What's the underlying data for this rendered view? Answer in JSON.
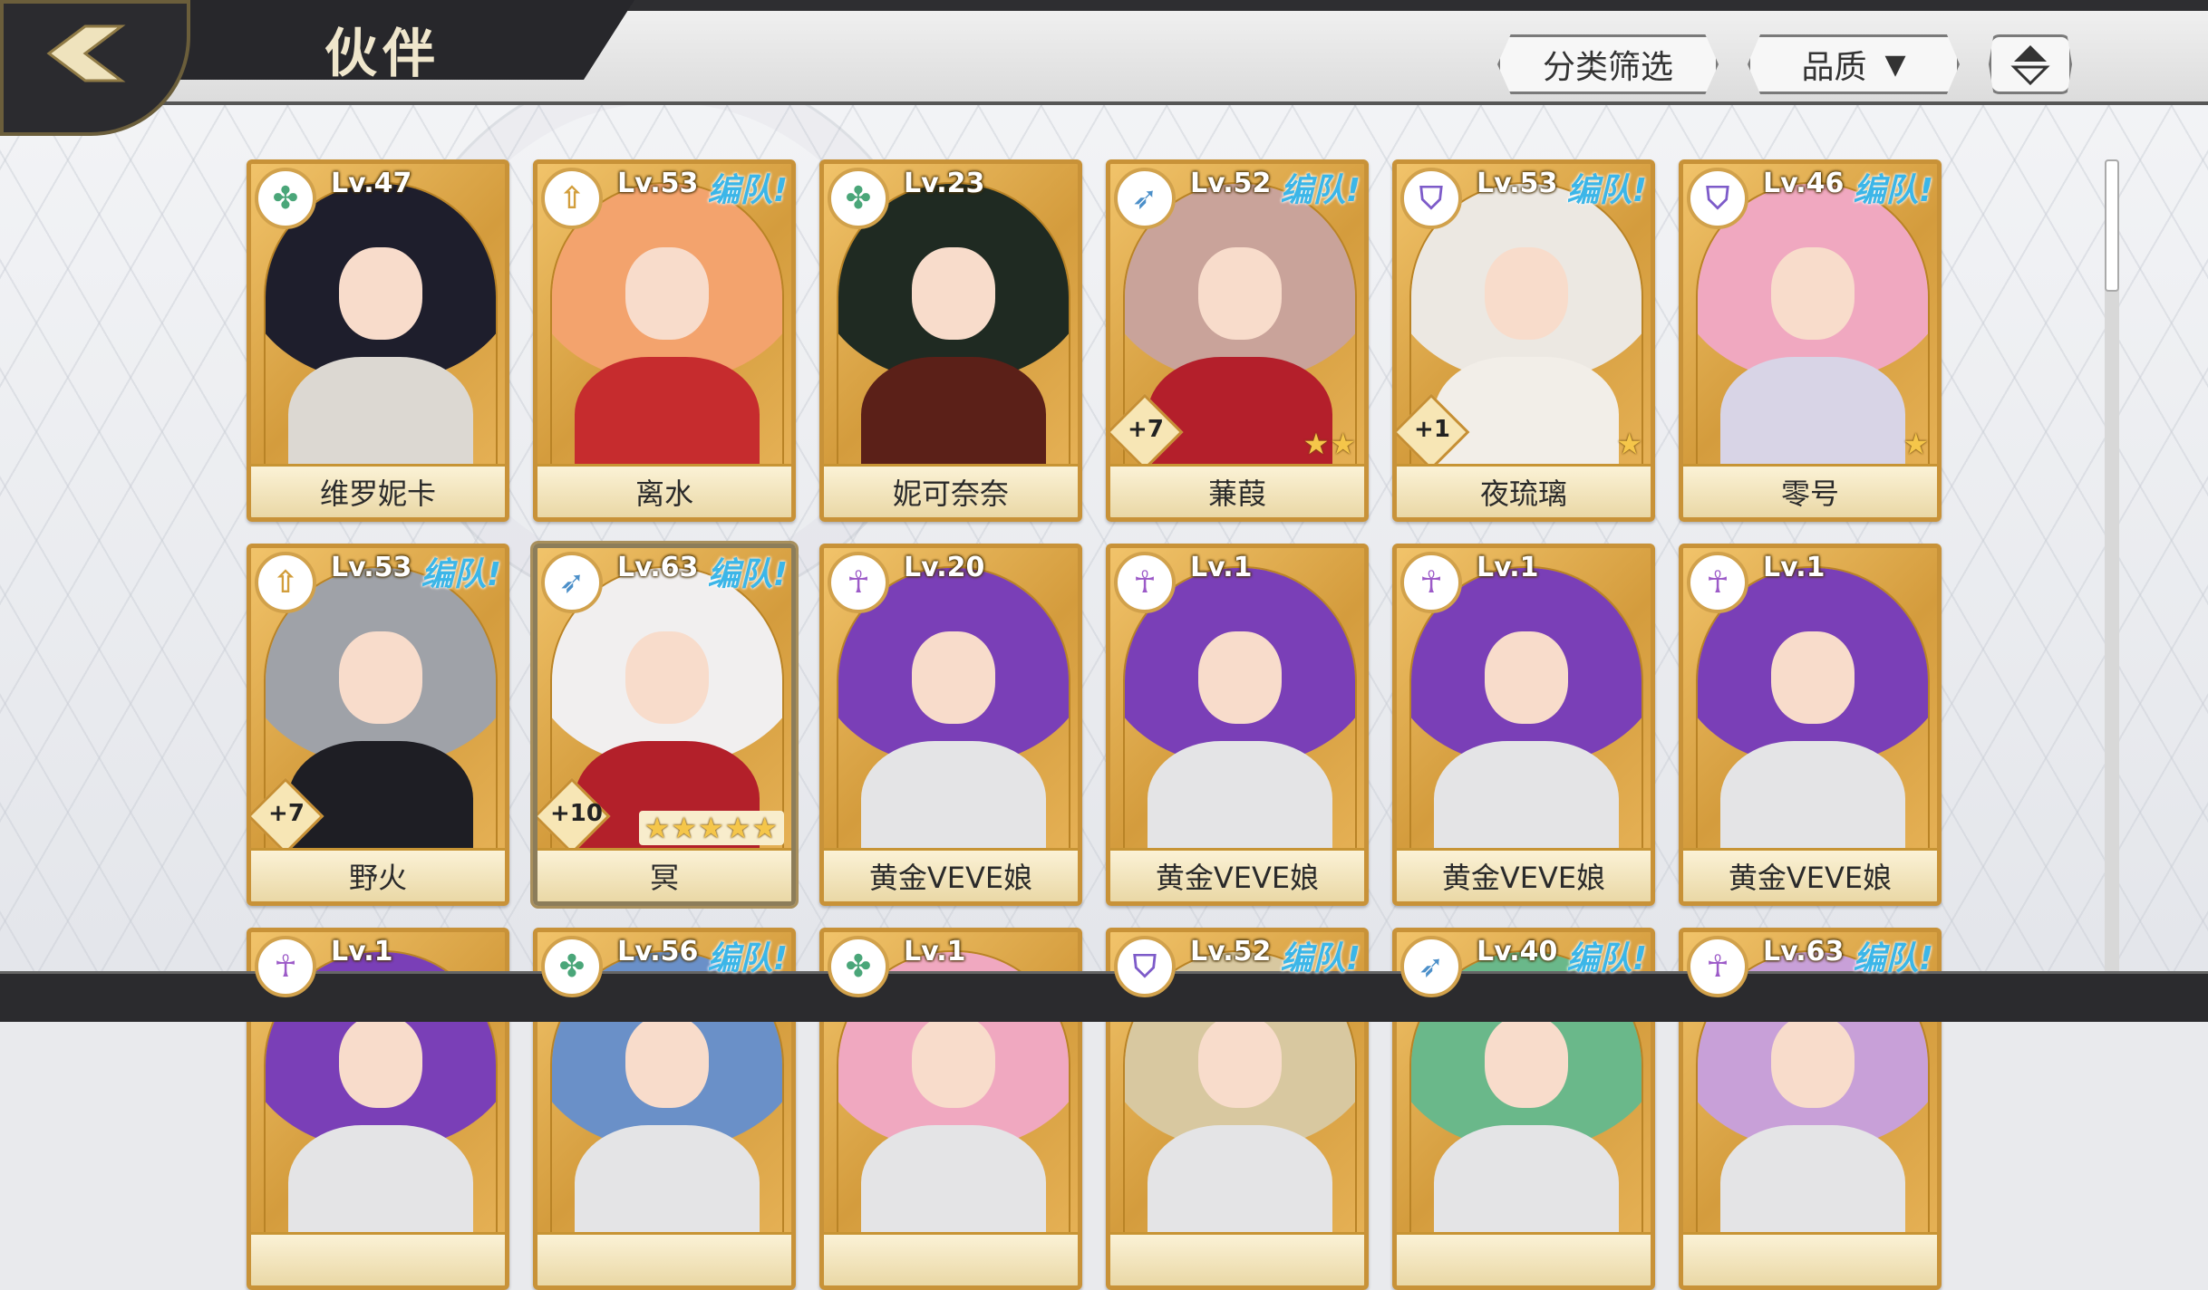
{
  "header": {
    "title": "伙伴",
    "filter_label": "分类筛选",
    "quality_label": "品质"
  },
  "accent": {
    "team_color": "#3cb6e8",
    "card_gold": "#d49c3d"
  },
  "team_tag": "编队!",
  "cards": [
    {
      "level": "Lv.47",
      "name": "维罗妮卡",
      "class_icon": "clover-icon",
      "icon_color": "#4aa679",
      "icon_glyph": "✤",
      "team": "",
      "plus": "",
      "stars": "",
      "hair": "#1e1e2c",
      "body": "#dcd8d2"
    },
    {
      "level": "Lv.53",
      "name": "离水",
      "class_icon": "sword-icon",
      "icon_color": "#d29e3c",
      "icon_glyph": "⇧",
      "team": "编队!",
      "plus": "",
      "stars": "",
      "hair": "#f3a36d",
      "body": "#c62c2e"
    },
    {
      "level": "Lv.23",
      "name": "妮可奈奈",
      "class_icon": "clover-icon",
      "icon_color": "#4aa679",
      "icon_glyph": "✤",
      "team": "",
      "plus": "",
      "stars": "",
      "hair": "#1f2a22",
      "body": "#5b2018"
    },
    {
      "level": "Lv.52",
      "name": "蒹葭",
      "class_icon": "bow-icon",
      "icon_color": "#4b8fc9",
      "icon_glyph": "➶",
      "team": "编队!",
      "plus": "+7",
      "stars": "★★",
      "hair": "#c9a39a",
      "body": "#b41f2b"
    },
    {
      "level": "Lv.53",
      "name": "夜琉璃",
      "class_icon": "shield-icon",
      "icon_color": "#7d5bc9",
      "icon_glyph": "⛉",
      "team": "编队!",
      "plus": "+1",
      "stars": "★",
      "hair": "#ece8e2",
      "body": "#f2eee8"
    },
    {
      "level": "Lv.46",
      "name": "零号",
      "class_icon": "shield-icon",
      "icon_color": "#7d5bc9",
      "icon_glyph": "⛉",
      "team": "编队!",
      "plus": "",
      "stars": "★",
      "hair": "#f0a8c0",
      "body": "#d8d4e6"
    },
    {
      "level": "Lv.53",
      "name": "野火",
      "class_icon": "sword-icon",
      "icon_color": "#d29e3c",
      "icon_glyph": "⇧",
      "team": "编队!",
      "plus": "+7",
      "stars": "",
      "hair": "#9fa2a8",
      "body": "#1e1e24"
    },
    {
      "level": "Lv.63",
      "name": "冥",
      "class_icon": "bow-icon",
      "icon_color": "#4b8fc9",
      "icon_glyph": "➶",
      "team": "编队!",
      "plus": "+10",
      "stars": "★★★★★",
      "hair": "#f1efef",
      "body": "#b3202a"
    },
    {
      "level": "Lv.20",
      "name": "黄金VEVE娘",
      "class_icon": "ankh-icon",
      "icon_color": "#9c5ac8",
      "icon_glyph": "☥",
      "team": "",
      "plus": "",
      "stars": "",
      "hair": "#7a3fb7",
      "body": "#e4e4e6"
    },
    {
      "level": "Lv.1",
      "name": "黄金VEVE娘",
      "class_icon": "ankh-icon",
      "icon_color": "#9c5ac8",
      "icon_glyph": "☥",
      "team": "",
      "plus": "",
      "stars": "",
      "hair": "#7a3fb7",
      "body": "#e4e4e6"
    },
    {
      "level": "Lv.1",
      "name": "黄金VEVE娘",
      "class_icon": "ankh-icon",
      "icon_color": "#9c5ac8",
      "icon_glyph": "☥",
      "team": "",
      "plus": "",
      "stars": "",
      "hair": "#7a3fb7",
      "body": "#e4e4e6"
    },
    {
      "level": "Lv.1",
      "name": "黄金VEVE娘",
      "class_icon": "ankh-icon",
      "icon_color": "#9c5ac8",
      "icon_glyph": "☥",
      "team": "",
      "plus": "",
      "stars": "",
      "hair": "#7a3fb7",
      "body": "#e4e4e6"
    },
    {
      "level": "Lv.1",
      "name": "",
      "class_icon": "ankh-icon",
      "icon_color": "#9c5ac8",
      "icon_glyph": "☥",
      "team": "",
      "plus": "",
      "stars": "",
      "hair": "#7a3fb7",
      "body": "#e4e4e6"
    },
    {
      "level": "Lv.56",
      "name": "",
      "class_icon": "clover-icon",
      "icon_color": "#4aa679",
      "icon_glyph": "✤",
      "team": "编队!",
      "plus": "",
      "stars": "",
      "hair": "#6a90c8",
      "body": "#e4e4e6"
    },
    {
      "level": "Lv.1",
      "name": "",
      "class_icon": "clover-icon",
      "icon_color": "#4aa679",
      "icon_glyph": "✤",
      "team": "",
      "plus": "",
      "stars": "",
      "hair": "#f0a8c0",
      "body": "#e4e4e6"
    },
    {
      "level": "Lv.52",
      "name": "",
      "class_icon": "shield-icon",
      "icon_color": "#7d5bc9",
      "icon_glyph": "⛉",
      "team": "编队!",
      "plus": "",
      "stars": "",
      "hair": "#d8c8a0",
      "body": "#e4e4e6"
    },
    {
      "level": "Lv.40",
      "name": "",
      "class_icon": "bow-icon",
      "icon_color": "#4b8fc9",
      "icon_glyph": "➶",
      "team": "编队!",
      "plus": "",
      "stars": "",
      "hair": "#6ab88a",
      "body": "#e4e4e6"
    },
    {
      "level": "Lv.63",
      "name": "",
      "class_icon": "ankh-icon",
      "icon_color": "#9c5ac8",
      "icon_glyph": "☥",
      "team": "编队!",
      "plus": "",
      "stars": "",
      "hair": "#c8a0d8",
      "body": "#e4e4e6"
    }
  ]
}
